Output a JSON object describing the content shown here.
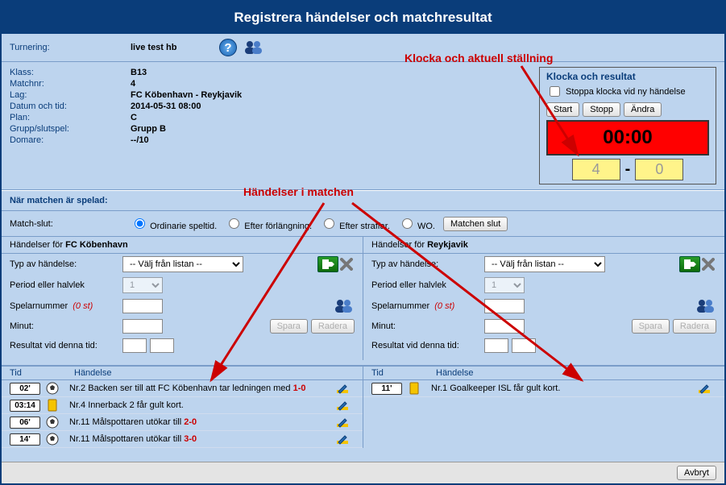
{
  "header_title": "Registrera händelser och matchresultat",
  "annotations": {
    "top_right": "Klocka och aktuell ställning",
    "mid": "Händelser i matchen"
  },
  "tournament_row": {
    "label": "Turnering:",
    "value": "live test hb"
  },
  "info_labels": {
    "klass": "Klass:",
    "matchnr": "Matchnr:",
    "lag": "Lag:",
    "datum": "Datum och tid:",
    "plan": "Plan:",
    "grupp": "Grupp/slutspel:",
    "domare": "Domare:"
  },
  "info_values": {
    "klass": "B13",
    "matchnr": "4",
    "lag": "FC Köbenhavn - Reykjavik",
    "datum": "2014-05-31 08:00",
    "plan": "C",
    "grupp": "Grupp B",
    "domare": "--/10"
  },
  "clock": {
    "title": "Klocka och resultat",
    "checkbox": "Stoppa klocka vid ny händelse",
    "start": "Start",
    "stopp": "Stopp",
    "andra": "Ändra",
    "time": "00:00",
    "score_home": "4",
    "score_away": "0"
  },
  "played_section": {
    "title": "När matchen är spelad:",
    "match_slut_label": "Match-slut:",
    "ordinarie": "Ordinarie speltid.",
    "forlangning": "Efter förlängning.",
    "straffar": "Efter straffar.",
    "wo": "WO.",
    "match_slut_btn": "Matchen slut"
  },
  "team_home": "FC Köbenhavn",
  "team_away": "Reykjavik",
  "handelser_for": "Händelser för",
  "form": {
    "typ": "Typ av händelse:",
    "typ_placeholder": "-- Välj från listan --",
    "period": "Period eller halvlek",
    "period_value": "1",
    "spelarnummer": "Spelarnummer",
    "zero": "(0 st)",
    "minut": "Minut:",
    "resultat_tid": "Resultat vid denna tid:",
    "spara": "Spara",
    "radera": "Radera"
  },
  "table_head": {
    "tid": "Tid",
    "handelse": "Händelse"
  },
  "events_home": [
    {
      "time": "02'",
      "type": "goal",
      "text_a": "Nr.2 Backen ser till att FC Köbenhavn tar ledningen med ",
      "score": "1-0"
    },
    {
      "time": "03:14",
      "type": "yellow",
      "text_a": "Nr.4 Innerback 2 får gult kort.",
      "score": ""
    },
    {
      "time": "06'",
      "type": "goal",
      "text_a": "Nr.11 Målspottaren utökar till ",
      "score": "2-0"
    },
    {
      "time": "14'",
      "type": "goal",
      "text_a": "Nr.11 Målspottaren utökar till ",
      "score": "3-0"
    }
  ],
  "events_away": [
    {
      "time": "11'",
      "type": "yellow",
      "text_a": "Nr.1 Goalkeeper ISL får gult kort.",
      "score": ""
    }
  ],
  "footer": {
    "avbryt": "Avbryt"
  }
}
